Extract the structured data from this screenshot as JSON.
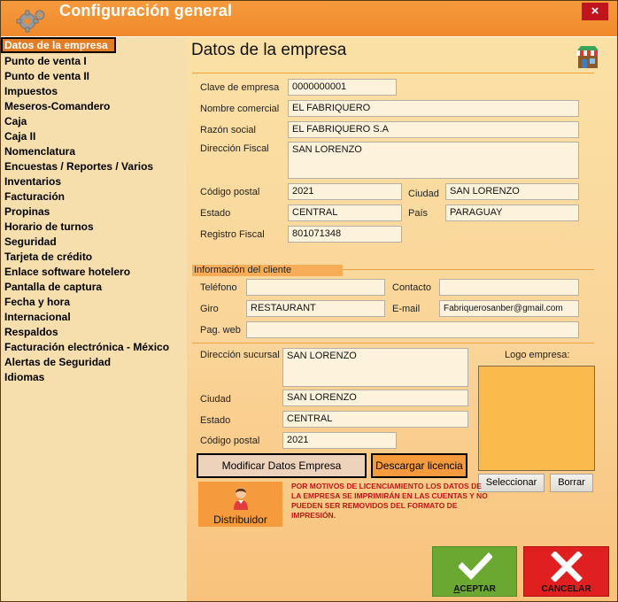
{
  "window": {
    "title": "Configuración general",
    "close_label": "×"
  },
  "sidebar": {
    "items": [
      {
        "label": "Datos de la empresa",
        "active": true
      },
      {
        "label": "Punto de venta I"
      },
      {
        "label": "Punto de venta II"
      },
      {
        "label": "Impuestos"
      },
      {
        "label": "Meseros-Comandero"
      },
      {
        "label": "Caja"
      },
      {
        "label": "Caja II"
      },
      {
        "label": "Nomenclatura"
      },
      {
        "label": "Encuestas / Reportes / Varios"
      },
      {
        "label": "Inventarios"
      },
      {
        "label": "Facturación"
      },
      {
        "label": "Propinas"
      },
      {
        "label": "Horario de turnos"
      },
      {
        "label": "Seguridad"
      },
      {
        "label": "Tarjeta de crédito"
      },
      {
        "label": "Enlace software hotelero"
      },
      {
        "label": "Pantalla de captura"
      },
      {
        "label": "Fecha y hora"
      },
      {
        "label": "Internacional"
      },
      {
        "label": "Respaldos"
      },
      {
        "label": "Facturación electrónica - México"
      },
      {
        "label": "Alertas de Seguridad"
      },
      {
        "label": "Idiomas"
      }
    ]
  },
  "page": {
    "title": "Datos de la empresa"
  },
  "company": {
    "clave_label": "Clave de empresa",
    "clave": "0000000001",
    "nombre_label": "Nombre comercial",
    "nombre": "EL FABRIQUERO",
    "razon_label": "Razón social",
    "razon": "EL FABRIQUERO S.A",
    "direccion_label": "Dirección Fiscal",
    "direccion": "SAN LORENZO",
    "cp_label": "Código postal",
    "cp": "2021",
    "ciudad_label": "Ciudad",
    "ciudad": "SAN LORENZO",
    "estado_label": "Estado",
    "estado": "CENTRAL",
    "pais_label": "País",
    "pais": "PARAGUAY",
    "registro_label": "Registro Fiscal",
    "registro": "801071348"
  },
  "client": {
    "section_label": "Información del cliente",
    "telefono_label": "Teléfono",
    "telefono": "",
    "contacto_label": "Contacto",
    "contacto": "",
    "giro_label": "Giro",
    "giro": "RESTAURANT",
    "email_label": "E-mail",
    "email": "Fabriquerosanber@gmail.com",
    "web_label": "Pag. web",
    "web": ""
  },
  "branch": {
    "direccion_label": "Dirección sucursal",
    "direccion": "SAN LORENZO",
    "ciudad_label": "Ciudad",
    "ciudad": "SAN LORENZO",
    "estado_label": "Estado",
    "estado": "CENTRAL",
    "cp_label": "Código postal",
    "cp": "2021"
  },
  "logo": {
    "label": "Logo empresa:",
    "select_label": "Seleccionar",
    "delete_label": "Borrar"
  },
  "actions": {
    "modify_label": "Modificar Datos Empresa",
    "license_label": "Descargar licencia",
    "distributor_label": "Distribuidor",
    "notice": "POR MOTIVOS DE LICENCIAMIENTO LOS DATOS DE LA EMPRESA SE IMPRIMIRÁN EN LAS CUENTAS Y NO PUEDEN SER REMOVIDOS DEL FORMATO DE IMPRESIÓN.",
    "accept_label": "ACEPTAR",
    "cancel_label": "CANCELAR"
  },
  "colors": {
    "titlebar": "#f08a2c",
    "accent_orange": "#f59a3d",
    "accept_green": "#6aa832",
    "cancel_red": "#e02020",
    "notice_red": "#c01515"
  },
  "icons": {
    "titlebar": "gear-icon",
    "page": "store-icon",
    "distributor": "person-icon",
    "accept": "check-icon",
    "cancel": "x-icon"
  }
}
